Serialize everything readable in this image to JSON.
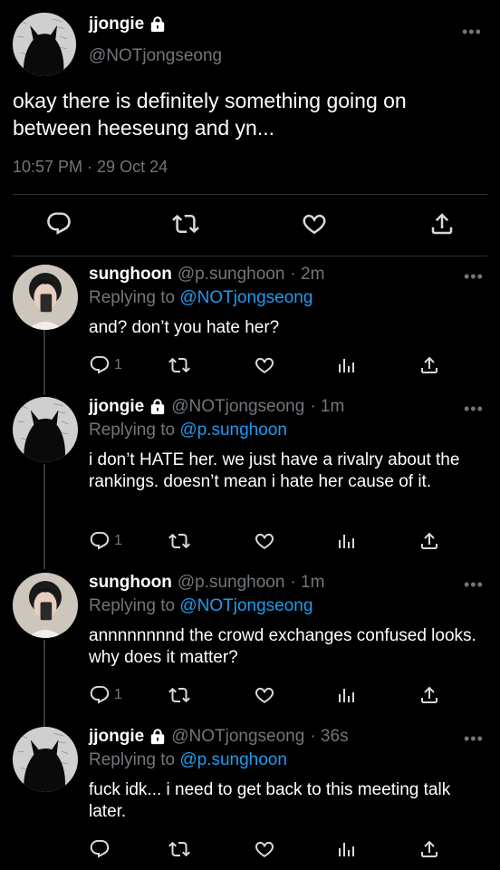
{
  "main_tweet": {
    "display_name": "jjongie",
    "handle": "@NOTjongseong",
    "text": "okay there is definitely something going on between heeseung and yn...",
    "timestamp": "10:57 PM · 29 Oct 24"
  },
  "replies": [
    {
      "display_name": "sunghoon",
      "handle": "@p.sunghoon",
      "time": "· 2m",
      "replying_prefix": "Replying to",
      "replying_to": "@NOTjongseong",
      "text": "and? don’t you hate her?",
      "reply_count": "1",
      "locked": false
    },
    {
      "display_name": "jjongie",
      "handle": "@NOTjongseong",
      "time": "· 1m",
      "replying_prefix": "Replying to",
      "replying_to": "@p.sunghoon",
      "text": "i don’t HATE her. we just have a rivalry about the rankings. doesn’t mean i hate her cause of it.",
      "reply_count": "1",
      "locked": true
    },
    {
      "display_name": "sunghoon",
      "handle": "@p.sunghoon",
      "time": "· 1m",
      "replying_prefix": "Replying to",
      "replying_to": "@NOTjongseong",
      "text": "annnnnnnnd the crowd exchanges confused looks. why does it matter?",
      "reply_count": "1",
      "locked": false
    },
    {
      "display_name": "jjongie",
      "handle": "@NOTjongseong",
      "time": "· 36s",
      "replying_prefix": "Replying to",
      "replying_to": "@p.sunghoon",
      "text": "fuck idk... i need to get back to this meeting talk later.",
      "reply_count": "",
      "locked": true
    }
  ],
  "icons": {
    "more": "more-icon",
    "lock": "lock-icon",
    "reply": "reply-icon",
    "retweet": "retweet-icon",
    "like": "heart-icon",
    "analytics": "analytics-icon",
    "share": "share-icon"
  },
  "colors": {
    "background": "#000000",
    "text": "#e7e9ea",
    "secondary": "#71767b",
    "mention": "#1d9bf0",
    "divider": "#2f3336"
  }
}
